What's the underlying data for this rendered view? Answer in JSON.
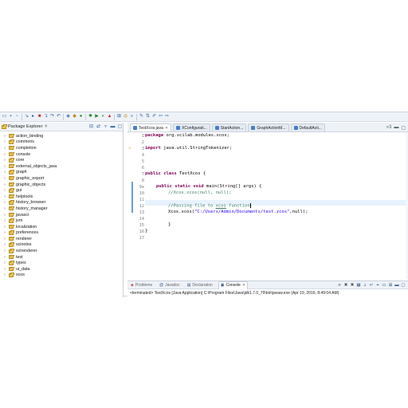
{
  "toolbar": {
    "icons": [
      "new-icon",
      "save-icon",
      "print-icon",
      "debug-icon",
      "run-icon",
      "coverage-icon",
      "external-tools-icon",
      "new-java-project-icon",
      "new-package-icon",
      "new-class-icon",
      "open-type-icon",
      "search-icon",
      "annotation-icon",
      "back-icon",
      "forward-icon"
    ]
  },
  "package_explorer": {
    "title": "Package Explorer",
    "items": [
      "action_binding",
      "commons",
      "completion",
      "console",
      "core",
      "external_objects_java",
      "graph",
      "graphic_export",
      "graphic_objects",
      "gui",
      "helptools",
      "history_browser",
      "history_manager",
      "javasci",
      "jvm",
      "localization",
      "preferences",
      "renderer",
      "scinotes",
      "scirenderer",
      "test",
      "types",
      "ui_data",
      "xcos"
    ]
  },
  "editor": {
    "tabs": [
      {
        "label": "TestXcos.java",
        "active": true
      },
      {
        "label": "XConfigurati...",
        "active": false
      },
      {
        "label": "StartAction...",
        "active": false
      },
      {
        "label": "GraphActionM...",
        "active": false
      },
      {
        "label": "DefaultActi...",
        "active": false
      }
    ],
    "overflow_count": "»3",
    "line_numbers": [
      "1",
      "2",
      "3",
      "4",
      "5",
      "6",
      "7",
      "8",
      "9⊖",
      "10",
      "11",
      "12",
      "13",
      "14",
      "15",
      "16",
      "17"
    ],
    "code": {
      "l1_kw": "package",
      "l1_rest": " org.scilab.modules.xcos;",
      "l3_kw": "import",
      "l3_rest": " java.util.StringTokenizer;",
      "l7_kw1": "public",
      "l7_kw2": "class",
      "l7_rest": " TestXcos {",
      "l9_kw1": "public",
      "l9_kw2": "static",
      "l9_kw3": "void",
      "l9_rest": " main(String[] args) {",
      "l10": "//Xcos.xcos(null, null);",
      "l12_a": "//Passing file to ",
      "l12_u": "xcos",
      "l12_b": " function",
      "l13_a": "Xcos.xcos(",
      "l13_s": "\"C:/Users/Admin/Documents/test.zcos\"",
      "l13_b": ",null);",
      "l15": "}",
      "l16": "}"
    }
  },
  "console": {
    "tabs": [
      "Problems",
      "Javadoc",
      "Declaration",
      "Console"
    ],
    "active_tab": "Console",
    "status": "<terminated> TestXcos [Java Application] C:\\Program Files\\Java\\jdk1.7.0_79\\bin\\javaw.exe (Apr 19, 2016, 8:49:04 AM)"
  }
}
